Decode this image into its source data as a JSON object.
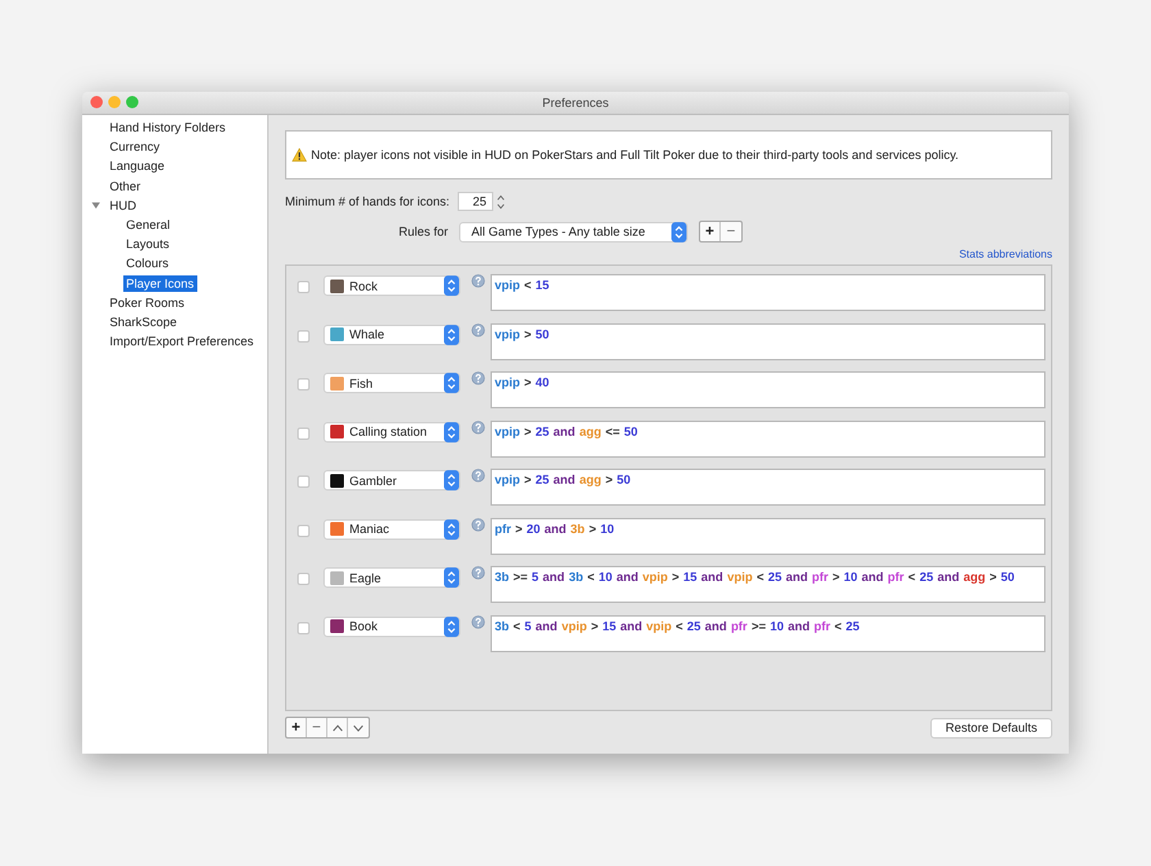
{
  "window": {
    "title": "Preferences"
  },
  "sidebar": {
    "items": [
      {
        "label": "Hand History Folders",
        "selected": false
      },
      {
        "label": "Currency",
        "selected": false
      },
      {
        "label": "Language",
        "selected": false
      },
      {
        "label": "Other",
        "selected": false
      },
      {
        "label": "HUD",
        "selected": false,
        "expanded": true,
        "children": [
          {
            "label": "General",
            "selected": false
          },
          {
            "label": "Layouts",
            "selected": false
          },
          {
            "label": "Colours",
            "selected": false
          },
          {
            "label": "Player Icons",
            "selected": true
          }
        ]
      },
      {
        "label": "Poker Rooms",
        "selected": false
      },
      {
        "label": "SharkScope",
        "selected": false
      },
      {
        "label": "Import/Export Preferences",
        "selected": false
      }
    ]
  },
  "note": "Note: player icons not visible in HUD on PokerStars and Full Tilt Poker due to their third-party tools and services policy.",
  "min_hands": {
    "label": "Minimum # of hands for icons:",
    "value": "25"
  },
  "rules_for": {
    "label": "Rules for",
    "value": "All Game Types - Any table size",
    "add": "+",
    "remove": "−"
  },
  "stats_link": "Stats abbreviations",
  "rules": [
    {
      "checked": false,
      "name": "Rock",
      "color": "#6b5a50",
      "condition": [
        {
          "text": "vpip",
          "color": "#2b7bd0"
        },
        {
          "text": "<",
          "color": "#333333"
        },
        {
          "text": "15",
          "color": "#3b3bd6"
        }
      ]
    },
    {
      "checked": false,
      "name": "Whale",
      "color": "#4aa8c8",
      "condition": [
        {
          "text": "vpip",
          "color": "#2b7bd0"
        },
        {
          "text": ">",
          "color": "#333333"
        },
        {
          "text": "50",
          "color": "#3b3bd6"
        }
      ]
    },
    {
      "checked": false,
      "name": "Fish",
      "color": "#f0a060",
      "condition": [
        {
          "text": "vpip",
          "color": "#2b7bd0"
        },
        {
          "text": ">",
          "color": "#333333"
        },
        {
          "text": "40",
          "color": "#3b3bd6"
        }
      ]
    },
    {
      "checked": false,
      "name": "Calling station",
      "color": "#cc2a2a",
      "condition": [
        {
          "text": "vpip",
          "color": "#2b7bd0"
        },
        {
          "text": ">",
          "color": "#333333"
        },
        {
          "text": "25",
          "color": "#3b3bd6"
        },
        {
          "text": "and",
          "color": "#6e2a90"
        },
        {
          "text": "agg",
          "color": "#e8912c"
        },
        {
          "text": "<=",
          "color": "#333333"
        },
        {
          "text": "50",
          "color": "#3b3bd6"
        }
      ]
    },
    {
      "checked": false,
      "name": "Gambler",
      "color": "#111111",
      "condition": [
        {
          "text": "vpip",
          "color": "#2b7bd0"
        },
        {
          "text": ">",
          "color": "#333333"
        },
        {
          "text": "25",
          "color": "#3b3bd6"
        },
        {
          "text": "and",
          "color": "#6e2a90"
        },
        {
          "text": "agg",
          "color": "#e8912c"
        },
        {
          "text": ">",
          "color": "#333333"
        },
        {
          "text": "50",
          "color": "#3b3bd6"
        }
      ]
    },
    {
      "checked": false,
      "name": "Maniac",
      "color": "#f07030",
      "condition": [
        {
          "text": "pfr",
          "color": "#2b7bd0"
        },
        {
          "text": ">",
          "color": "#333333"
        },
        {
          "text": "20",
          "color": "#3b3bd6"
        },
        {
          "text": "and",
          "color": "#6e2a90"
        },
        {
          "text": "3b",
          "color": "#e8912c"
        },
        {
          "text": ">",
          "color": "#333333"
        },
        {
          "text": "10",
          "color": "#3b3bd6"
        }
      ]
    },
    {
      "checked": false,
      "name": "Eagle",
      "color": "#b8b8b8",
      "condition": [
        {
          "text": "3b",
          "color": "#2b7bd0"
        },
        {
          "text": ">=",
          "color": "#333333"
        },
        {
          "text": "5",
          "color": "#3b3bd6"
        },
        {
          "text": "and",
          "color": "#6e2a90"
        },
        {
          "text": "3b",
          "color": "#2b7bd0"
        },
        {
          "text": "<",
          "color": "#333333"
        },
        {
          "text": "10",
          "color": "#3b3bd6"
        },
        {
          "text": "and",
          "color": "#6e2a90"
        },
        {
          "text": "vpip",
          "color": "#e8912c"
        },
        {
          "text": ">",
          "color": "#333333"
        },
        {
          "text": "15",
          "color": "#3b3bd6"
        },
        {
          "text": "and",
          "color": "#6e2a90"
        },
        {
          "text": "vpip",
          "color": "#e8912c"
        },
        {
          "text": "<",
          "color": "#333333"
        },
        {
          "text": "25",
          "color": "#3b3bd6"
        },
        {
          "text": "and",
          "color": "#6e2a90"
        },
        {
          "text": "pfr",
          "color": "#c447d6"
        },
        {
          "text": ">",
          "color": "#333333"
        },
        {
          "text": "10",
          "color": "#3b3bd6"
        },
        {
          "text": "and",
          "color": "#6e2a90"
        },
        {
          "text": "pfr",
          "color": "#c447d6"
        },
        {
          "text": "<",
          "color": "#333333"
        },
        {
          "text": "25",
          "color": "#3b3bd6"
        },
        {
          "text": "and",
          "color": "#6e2a90"
        },
        {
          "text": "agg",
          "color": "#d9352c"
        },
        {
          "text": ">",
          "color": "#333333"
        },
        {
          "text": "50",
          "color": "#3b3bd6"
        }
      ]
    },
    {
      "checked": false,
      "name": "Book",
      "color": "#8a2a6a",
      "condition": [
        {
          "text": "3b",
          "color": "#2b7bd0"
        },
        {
          "text": "<",
          "color": "#333333"
        },
        {
          "text": "5",
          "color": "#3b3bd6"
        },
        {
          "text": "and",
          "color": "#6e2a90"
        },
        {
          "text": "vpip",
          "color": "#e8912c"
        },
        {
          "text": ">",
          "color": "#333333"
        },
        {
          "text": "15",
          "color": "#3b3bd6"
        },
        {
          "text": "and",
          "color": "#6e2a90"
        },
        {
          "text": "vpip",
          "color": "#e8912c"
        },
        {
          "text": "<",
          "color": "#333333"
        },
        {
          "text": "25",
          "color": "#3b3bd6"
        },
        {
          "text": "and",
          "color": "#6e2a90"
        },
        {
          "text": "pfr",
          "color": "#c447d6"
        },
        {
          "text": ">=",
          "color": "#333333"
        },
        {
          "text": "10",
          "color": "#3b3bd6"
        },
        {
          "text": "and",
          "color": "#6e2a90"
        },
        {
          "text": "pfr",
          "color": "#c447d6"
        },
        {
          "text": "<",
          "color": "#333333"
        },
        {
          "text": "25",
          "color": "#3b3bd6"
        }
      ]
    }
  ],
  "list_buttons": {
    "add": "+",
    "remove": "−"
  },
  "restore": "Restore Defaults"
}
